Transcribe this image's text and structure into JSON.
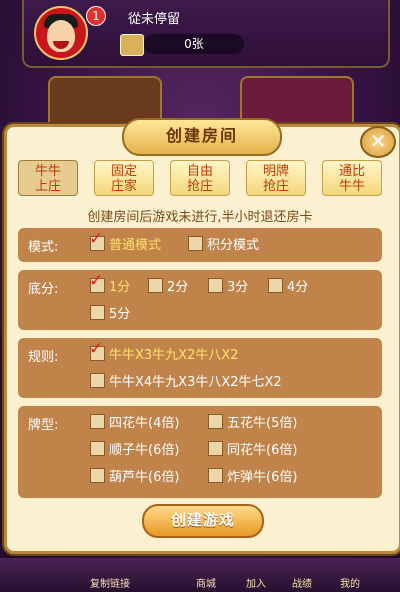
{
  "player": {
    "name": "從未停留",
    "notification_count": "1",
    "card_count": "0张"
  },
  "bottom_nav": [
    "复制链接",
    "商城",
    "加入",
    "战绩",
    "我的"
  ],
  "dialog": {
    "title": "创建房间",
    "close_icon": "close-icon",
    "tabs": [
      {
        "line1": "牛牛",
        "line2": "上庄",
        "active": true
      },
      {
        "line1": "固定",
        "line2": "庄家",
        "active": false
      },
      {
        "line1": "自由",
        "line2": "抢庄",
        "active": false
      },
      {
        "line1": "明牌",
        "line2": "抢庄",
        "active": false
      },
      {
        "line1": "通比",
        "line2": "牛牛",
        "active": false
      }
    ],
    "notice": "创建房间后游戏未进行,半小时退还房卡",
    "mode": {
      "label": "模式:",
      "options": [
        {
          "text": "普通模式",
          "checked": true
        },
        {
          "text": "积分模式",
          "checked": false
        }
      ]
    },
    "base_score": {
      "label": "底分:",
      "options": [
        {
          "text": "1分",
          "checked": true
        },
        {
          "text": "2分",
          "checked": false
        },
        {
          "text": "3分",
          "checked": false
        },
        {
          "text": "4分",
          "checked": false
        },
        {
          "text": "5分",
          "checked": false
        }
      ]
    },
    "rules": {
      "label": "规则:",
      "options": [
        {
          "text": "牛牛X3牛九X2牛八X2",
          "checked": true
        },
        {
          "text": "牛牛X4牛九X3牛八X2牛七X2",
          "checked": false
        }
      ]
    },
    "card_types": {
      "label": "牌型:",
      "options": [
        {
          "text": "四花牛(4倍)",
          "checked": false
        },
        {
          "text": "五花牛(5倍)",
          "checked": false
        },
        {
          "text": "顺子牛(6倍)",
          "checked": false
        },
        {
          "text": "同花牛(6倍)",
          "checked": false
        },
        {
          "text": "葫芦牛(6倍)",
          "checked": false
        },
        {
          "text": "炸弹牛(6倍)",
          "checked": false
        }
      ]
    },
    "confirm_label": "创建游戏",
    "colors": {
      "checked_text": "#ffe06a",
      "section_bg": "#c0844b",
      "tick": "#e01818"
    }
  }
}
